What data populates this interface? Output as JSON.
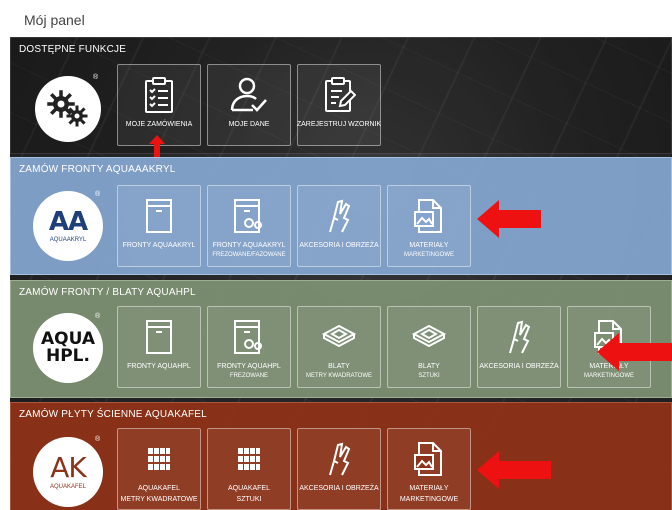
{
  "header": {
    "title": "Mój panel"
  },
  "sections": {
    "available": {
      "title": "DOSTĘPNE FUNKCJE",
      "reg": "®",
      "tiles": [
        {
          "label": "MOJE ZAMÓWIENIA",
          "icon": "clipboard-checklist-icon"
        },
        {
          "label": "MOJE DANE",
          "icon": "user-check-icon"
        },
        {
          "label": "ZAREJESTRUJ WZORNIK",
          "icon": "clipboard-edit-icon"
        }
      ]
    },
    "aquaakryl": {
      "title": "ZAMÓW FRONTY AQUAAAKRYL",
      "logo_letters": "AA",
      "logo_text": "AQUAAKRYL",
      "reg": "®",
      "tiles": [
        {
          "label": "FRONTY AQUAAKRYL",
          "sub": "",
          "icon": "cabinet-door-icon"
        },
        {
          "label": "FRONTY AQUAAKRYL",
          "sub": "FREZOWANE/FAZOWANE",
          "icon": "cabinet-door-gear-icon"
        },
        {
          "label": "AKCESORIA I OBRZEŻA",
          "sub": "",
          "icon": "hand-edge-icon"
        },
        {
          "label": "MATERIAŁY",
          "sub": "MARKETINGOWE",
          "icon": "document-image-icon"
        }
      ]
    },
    "aquahpl": {
      "title": "ZAMÓW FRONTY / BLATY AQUAHPL",
      "logo_line1": "AQUA",
      "logo_line2": "HPL.",
      "reg": "®",
      "tiles": [
        {
          "label": "FRONTY AQUAHPL",
          "sub": "",
          "icon": "cabinet-door-icon"
        },
        {
          "label": "FRONTY AQUAHPL",
          "sub": "FREZOWANE",
          "icon": "cabinet-door-gear-icon"
        },
        {
          "label": "BLATY",
          "sub": "METRY KWADRATOWE",
          "icon": "countertop-icon"
        },
        {
          "label": "BLATY",
          "sub": "SZTUKI",
          "icon": "countertop-icon"
        },
        {
          "label": "AKCESORIA I OBRZEŻA",
          "sub": "",
          "icon": "hand-edge-icon"
        },
        {
          "label": "MATERIAŁY",
          "sub": "MARKETINGOWE",
          "icon": "document-image-icon"
        }
      ]
    },
    "aquakafel": {
      "title": "ZAMÓW PŁYTY ŚCIENNE AQUAKAFEL",
      "logo_letters": "AK",
      "logo_text": "AQUAKAFEL",
      "reg": "®",
      "tiles": [
        {
          "label": "AQUAKAFEL",
          "sub": "METRY KWADRATOWE",
          "icon": "tile-grid-icon"
        },
        {
          "label": "AQUAKAFEL",
          "sub": "SZTUKI",
          "icon": "tile-grid-icon"
        },
        {
          "label": "AKCESORIA I OBRZEŻA",
          "sub": "",
          "icon": "hand-edge-icon"
        },
        {
          "label": "MATERIAŁY",
          "sub": "MARKETINGOWE",
          "icon": "document-image-icon"
        }
      ]
    }
  },
  "colors": {
    "blue_section": "#84a4cf",
    "green_section": "#7c8f71",
    "red_section": "#8c3218",
    "arrow": "#ee1111"
  }
}
